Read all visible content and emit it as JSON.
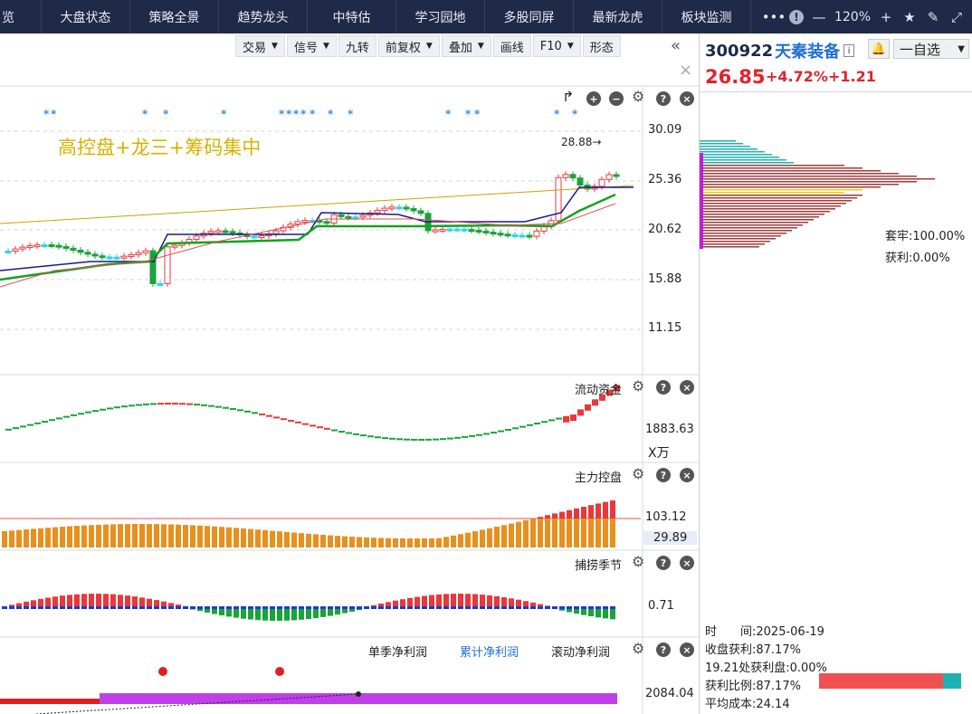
{
  "nav": {
    "tabs": [
      "览",
      "大盘状态",
      "策略全景",
      "趋势龙头",
      "中特估",
      "学习园地",
      "多股同屏",
      "最新龙虎",
      "板块监测"
    ],
    "zoom": "120%",
    "more_label": "•••"
  },
  "toolbar": {
    "items": [
      {
        "label": "交易",
        "dropdown": true
      },
      {
        "label": "信号",
        "dropdown": true
      },
      {
        "label": "九转",
        "dropdown": false
      },
      {
        "label": "前复权",
        "dropdown": true
      },
      {
        "label": "叠加",
        "dropdown": true
      },
      {
        "label": "画线",
        "dropdown": false
      },
      {
        "label": "F10",
        "dropdown": true
      },
      {
        "label": "形态",
        "dropdown": false
      }
    ]
  },
  "stock": {
    "code": "300922",
    "name": "天秦装备",
    "price": "26.85",
    "change_pct": "+4.72%",
    "change": "+1.21",
    "watch_label": "一自选"
  },
  "main_chart": {
    "title": "高控盘+龙三+筹码集中",
    "price_labels": [
      "30.09",
      "25.36",
      "20.62",
      "15.88",
      "11.15"
    ],
    "high_marker": "28.88→",
    "colors": {
      "up": "#e8383c",
      "down": "#1aa33a",
      "flat": "#30d6e6",
      "title": "#d8b000"
    }
  },
  "panels": {
    "flow": {
      "title": "流动资金",
      "value": "1883.63",
      "unit": "X万"
    },
    "control": {
      "title": "主力控盘",
      "value": "103.12",
      "value2": "29.89"
    },
    "season": {
      "title": "捕捞季节",
      "value": "0.71"
    },
    "profit": {
      "tabs": [
        "单季净利润",
        "累计净利润",
        "滚动净利润"
      ],
      "value": "2084.04"
    }
  },
  "chips": {
    "trap": "套牢:100.00%",
    "gain": "获利:0.00%",
    "date_label": "时　　间:2025-06-19",
    "close_profit": "收盘获利:87.17%",
    "at_price": "19.21处获利盘:0.00%",
    "profit_ratio": "获利比例:87.17%",
    "avg_cost": "平均成本:24.14"
  }
}
